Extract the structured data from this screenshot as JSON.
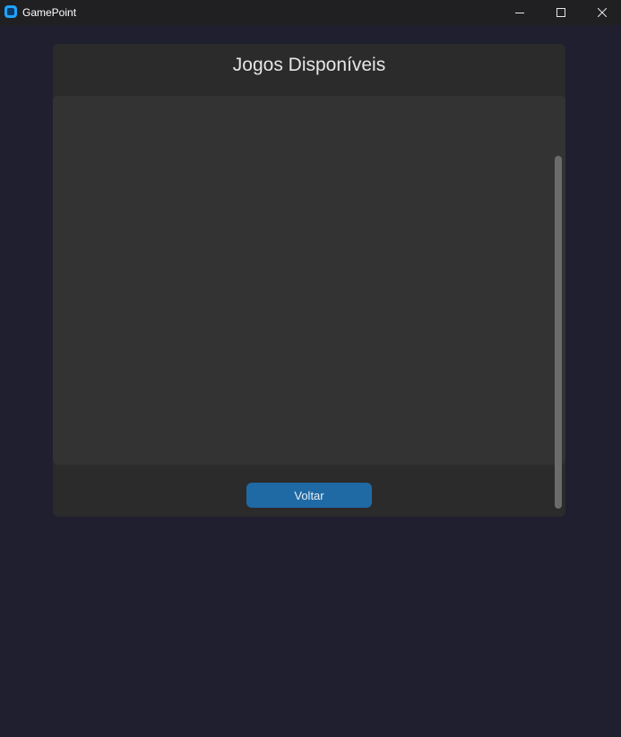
{
  "window": {
    "title": "GamePoint",
    "icon": "app-logo-icon",
    "controls": [
      "minimize-icon",
      "maximize-icon",
      "close-icon"
    ]
  },
  "main": {
    "title": "Jogos Disponíveis",
    "games": [],
    "back_label": "Voltar"
  },
  "colors": {
    "background": "#201f2f",
    "panel": "#2b2b2b",
    "list": "#333333",
    "accent": "#1f6aa5",
    "app_icon": "#1fa2ff"
  }
}
